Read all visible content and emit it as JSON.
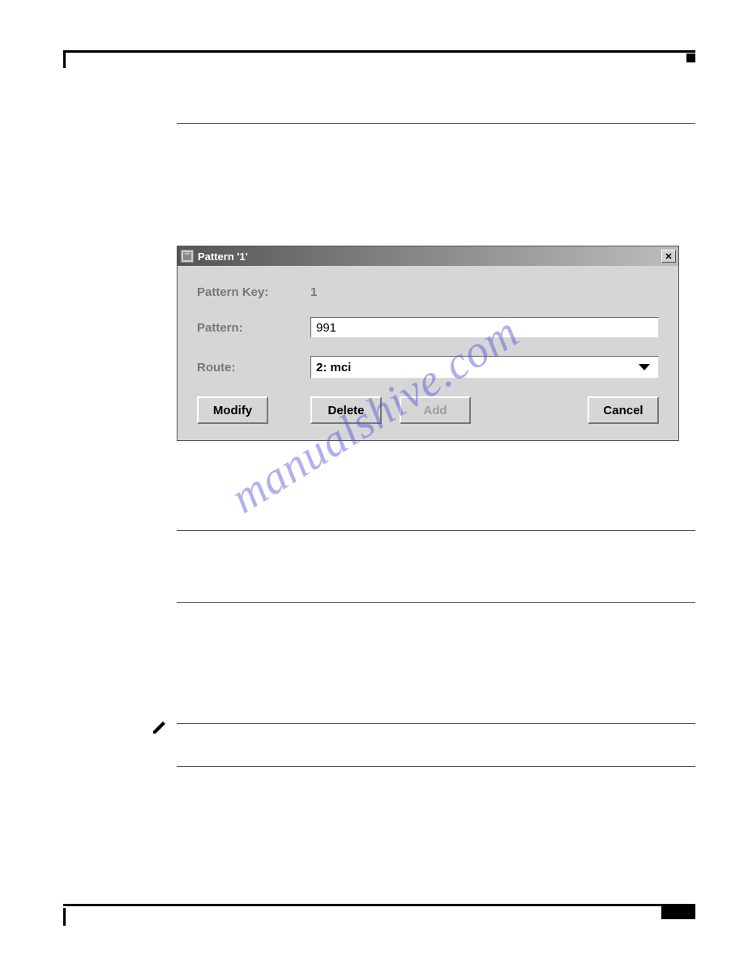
{
  "dialog": {
    "title": "Pattern '1'",
    "close_glyph": "✕",
    "fields": {
      "pattern_key_label": "Pattern Key:",
      "pattern_key_value": "1",
      "pattern_label": "Pattern:",
      "pattern_value": "991",
      "route_label": "Route:",
      "route_value": "2: mci"
    },
    "buttons": {
      "modify": "Modify",
      "delete": "Delete",
      "add": "Add",
      "cancel": "Cancel"
    }
  },
  "watermark": "manualshive.com"
}
